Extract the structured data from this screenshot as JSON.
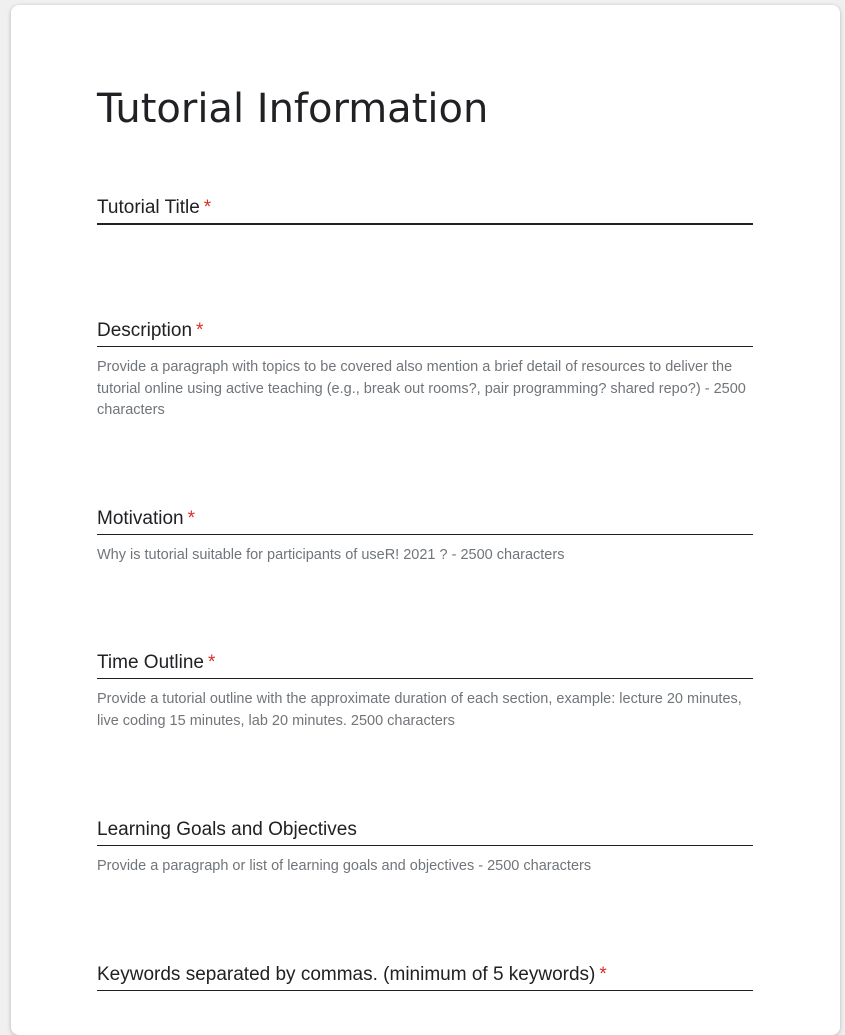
{
  "form": {
    "title": "Tutorial Information",
    "required_marker": "*",
    "fields": [
      {
        "label": "Tutorial Title",
        "required": true,
        "help": ""
      },
      {
        "label": "Description",
        "required": true,
        "help": "Provide a paragraph with topics to be covered also mention a brief detail of resources to deliver the tutorial online using active teaching (e.g., break out rooms?, pair programming? shared repo?) - 2500 characters"
      },
      {
        "label": "Motivation",
        "required": true,
        "help": "Why is tutorial suitable for participants of useR! 2021 ? - 2500 characters"
      },
      {
        "label": "Time Outline",
        "required": true,
        "help": "Provide a tutorial outline with the approximate duration of each section, example: lecture 20 minutes, live coding 15 minutes, lab 20 minutes. 2500 characters"
      },
      {
        "label": "Learning Goals and Objectives",
        "required": false,
        "help": "Provide a paragraph or list of learning goals and objectives - 2500 characters"
      },
      {
        "label": "Keywords separated by commas. (minimum of 5 keywords)",
        "required": true,
        "help": ""
      }
    ]
  }
}
